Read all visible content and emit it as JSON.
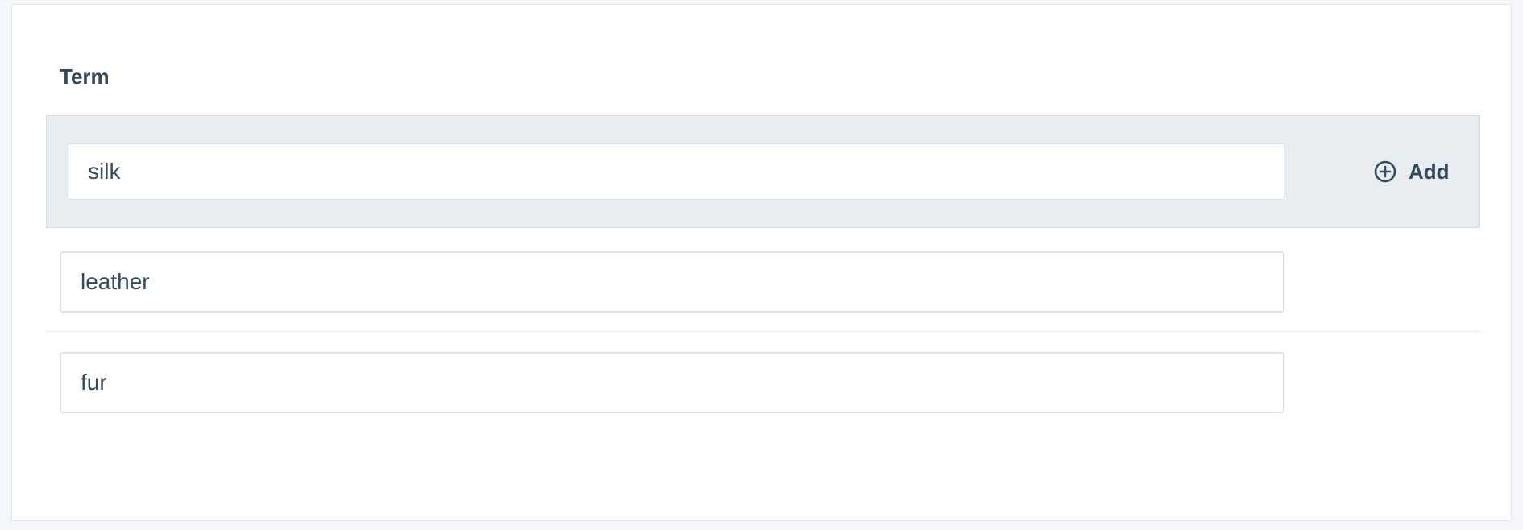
{
  "section": {
    "label": "Term"
  },
  "add_row": {
    "input_value": "silk",
    "button_label": "Add",
    "button_icon": "plus-circle-icon"
  },
  "terms": [
    {
      "value": "leather"
    },
    {
      "value": "fur"
    }
  ],
  "colors": {
    "text": "#34495e",
    "add_row_bg": "#e7ecf0",
    "page_bg": "#f4f6f9"
  }
}
